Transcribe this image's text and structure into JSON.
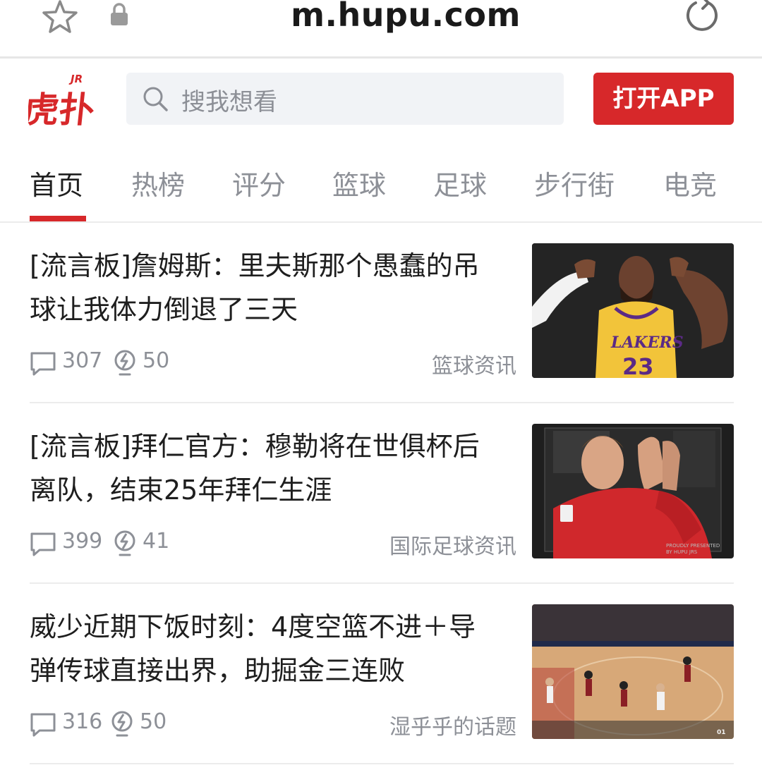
{
  "browser": {
    "url": "m.hupu.com"
  },
  "header": {
    "logo_text": "虎扑",
    "logo_badge": "JR",
    "search_placeholder": "搜我想看",
    "open_app_label": "打开APP"
  },
  "nav": {
    "tabs": [
      {
        "label": "首页",
        "active": true
      },
      {
        "label": "热榜",
        "active": false
      },
      {
        "label": "评分",
        "active": false
      },
      {
        "label": "篮球",
        "active": false
      },
      {
        "label": "足球",
        "active": false
      },
      {
        "label": "步行街",
        "active": false
      },
      {
        "label": "电竞",
        "active": false
      }
    ]
  },
  "feed": {
    "items": [
      {
        "title_line1": "[流言板]詹姆斯：里夫斯那个愚蠢的吊",
        "title_line2": "球让我体力倒退了三天",
        "comments": "307",
        "lights": "50",
        "category": "篮球资讯",
        "thumb_icon": "lakers-player-thumbnail"
      },
      {
        "title_line1": "[流言板]拜仁官方：穆勒将在世俱杯后",
        "title_line2": "离队，结束25年拜仁生涯",
        "comments": "399",
        "lights": "41",
        "category": "国际足球资讯",
        "thumb_icon": "bayern-player-thumbnail"
      },
      {
        "title_line1": "威少近期下饭时刻：4度空篮不进＋导",
        "title_line2": "弹传球直接出界，助掘金三连败",
        "comments": "316",
        "lights": "50",
        "category": "湿乎乎的话题",
        "thumb_icon": "basketball-court-thumbnail"
      }
    ]
  },
  "colors": {
    "brand_red": "#d7282a",
    "muted_text": "#8d9097",
    "search_bg": "#f1f3f6"
  }
}
